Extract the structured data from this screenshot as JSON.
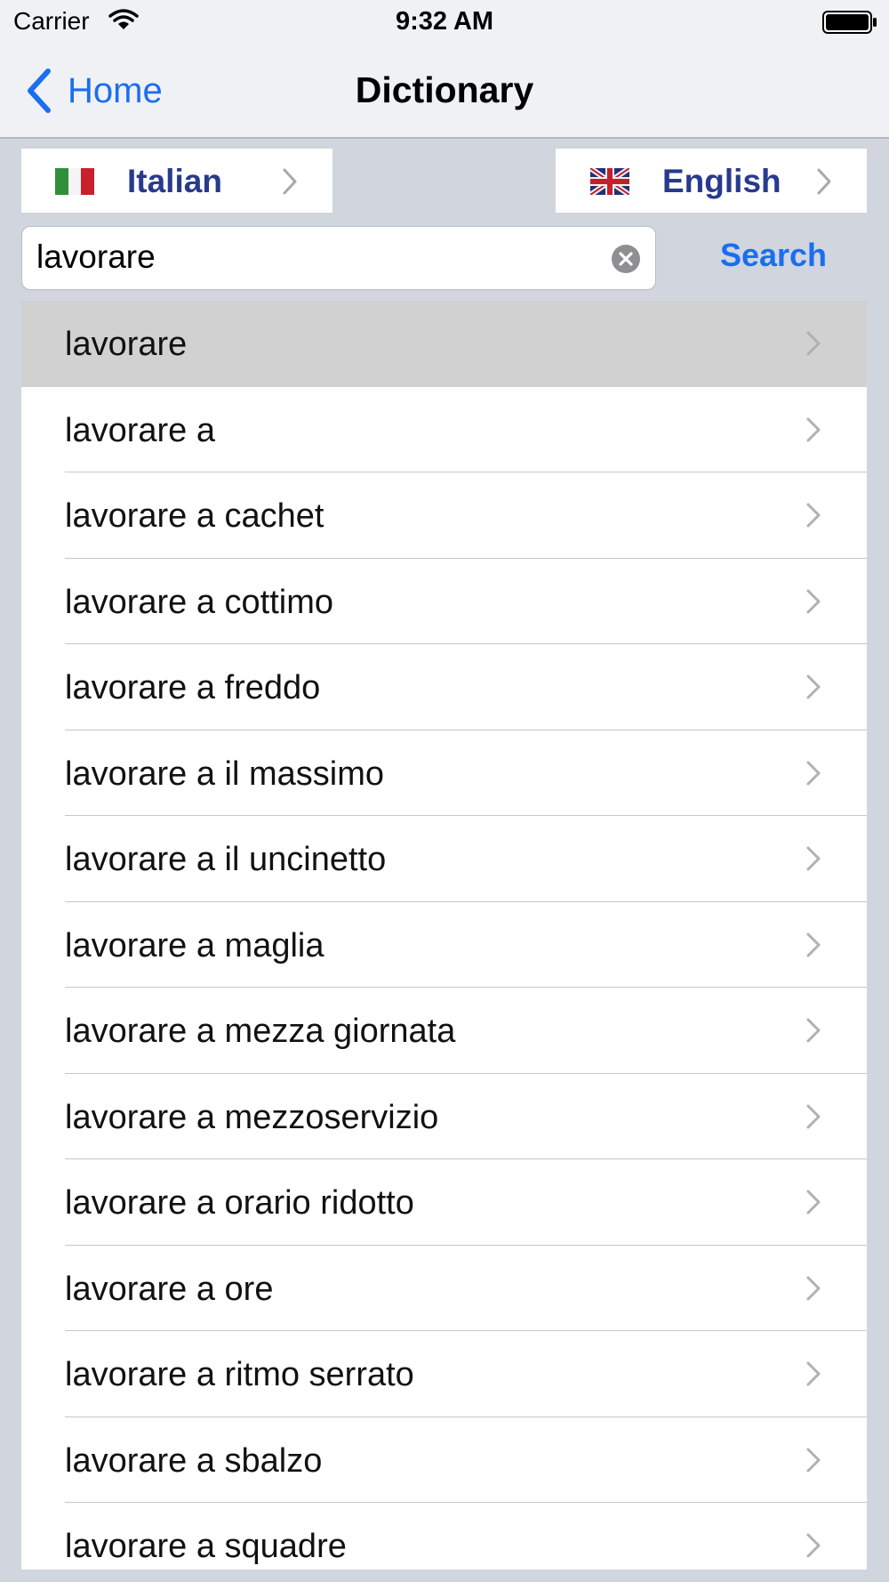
{
  "status_bar": {
    "carrier": "Carrier",
    "time": "9:32 AM"
  },
  "nav": {
    "back_label": "Home",
    "title": "Dictionary"
  },
  "languages": {
    "from": "Italian",
    "to": "English"
  },
  "search": {
    "value": "lavorare",
    "button_label": "Search"
  },
  "results": [
    "lavorare",
    "lavorare a",
    "lavorare a cachet",
    "lavorare a cottimo",
    "lavorare a freddo",
    "lavorare a il massimo",
    "lavorare a il uncinetto",
    "lavorare a maglia",
    "lavorare a mezza giornata",
    "lavorare a mezzoservizio",
    "lavorare a orario ridotto",
    "lavorare a ore",
    "lavorare a ritmo serrato",
    "lavorare a sbalzo",
    "lavorare a squadre"
  ],
  "selected_result": "lavorare",
  "colors": {
    "accent": "#1a6ef0",
    "language_label": "#283a8c",
    "selected_row": "#d1d1d1",
    "background": "#d0d5de"
  },
  "icons": {
    "back": "chevron-left-icon",
    "row": "chevron-right-icon",
    "clear": "clear-circle-icon",
    "from_flag": "italy-flag-icon",
    "to_flag": "uk-flag-icon"
  }
}
